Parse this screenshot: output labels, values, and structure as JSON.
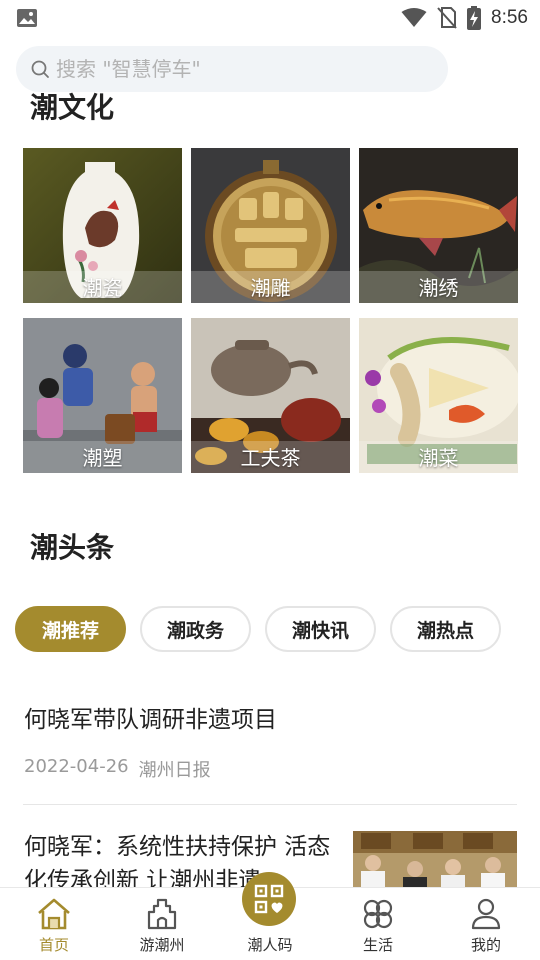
{
  "status_bar": {
    "time": "8:56"
  },
  "search": {
    "placeholder": "搜索 \"智慧停车\""
  },
  "culture": {
    "title": "潮文化",
    "items": [
      {
        "label": "潮瓷"
      },
      {
        "label": "潮雕"
      },
      {
        "label": "潮绣"
      },
      {
        "label": "潮塑"
      },
      {
        "label": "工夫茶"
      },
      {
        "label": "潮菜"
      }
    ]
  },
  "headlines": {
    "title": "潮头条",
    "tabs": [
      {
        "label": "潮推荐",
        "active": true
      },
      {
        "label": "潮政务",
        "active": false
      },
      {
        "label": "潮快讯",
        "active": false
      },
      {
        "label": "潮热点",
        "active": false
      }
    ],
    "news": [
      {
        "title": "何晓军带队调研非遗项目",
        "date": "2022-04-26",
        "source": "潮州日报"
      },
      {
        "title": "何晓军：系统性扶持保护 活态化传承创新 让潮州非遗"
      }
    ]
  },
  "bottom_nav": {
    "items": [
      {
        "label": "首页",
        "icon": "home-icon",
        "active": true
      },
      {
        "label": "游潮州",
        "icon": "landmark-icon",
        "active": false
      },
      {
        "label": "潮人码",
        "icon": "qr-code-icon",
        "active": false
      },
      {
        "label": "生活",
        "icon": "clover-icon",
        "active": false
      },
      {
        "label": "我的",
        "icon": "user-icon",
        "active": false
      }
    ]
  },
  "colors": {
    "accent": "#a48b2e",
    "search_bg": "#f1f4f7",
    "meta_text": "#9a9a9a"
  }
}
